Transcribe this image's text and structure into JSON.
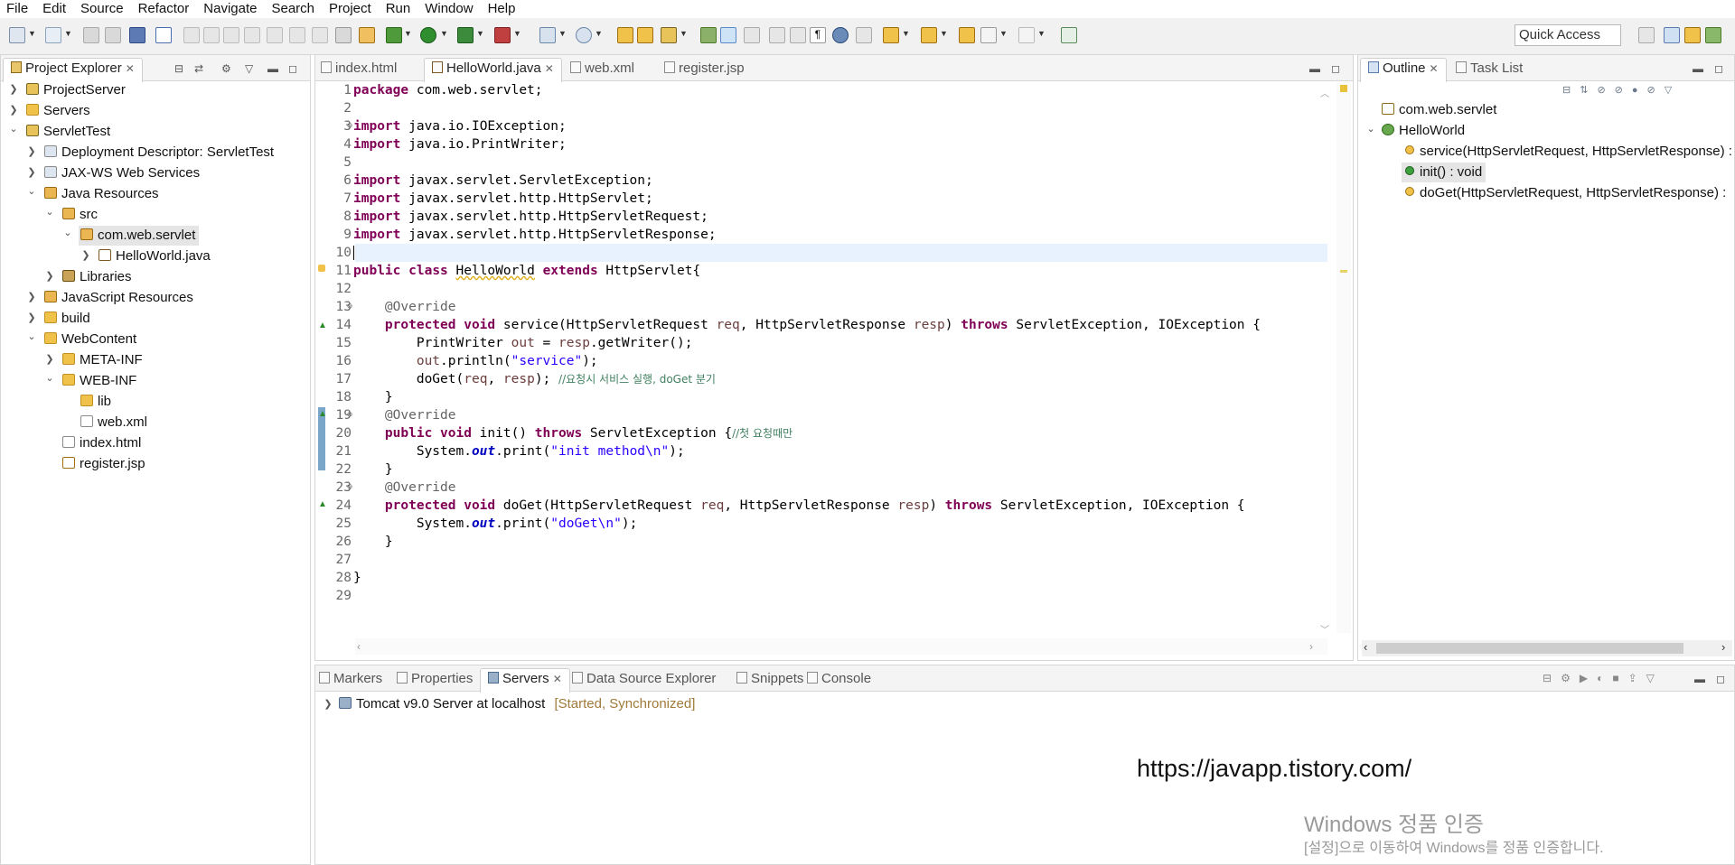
{
  "menu": [
    "File",
    "Edit",
    "Source",
    "Refactor",
    "Navigate",
    "Search",
    "Project",
    "Run",
    "Window",
    "Help"
  ],
  "toolbar": {
    "quick_access": "Quick Access"
  },
  "project_explorer": {
    "title": "Project Explorer",
    "items": [
      {
        "label": "ProjectServer"
      },
      {
        "label": "Servers"
      },
      {
        "label": "ServletTest"
      },
      {
        "label": "Deployment Descriptor: ServletTest"
      },
      {
        "label": "JAX-WS Web Services"
      },
      {
        "label": "Java Resources"
      },
      {
        "label": "src"
      },
      {
        "label": "com.web.servlet"
      },
      {
        "label": "HelloWorld.java"
      },
      {
        "label": "Libraries"
      },
      {
        "label": "JavaScript Resources"
      },
      {
        "label": "build"
      },
      {
        "label": "WebContent"
      },
      {
        "label": "META-INF"
      },
      {
        "label": "WEB-INF"
      },
      {
        "label": "lib"
      },
      {
        "label": "web.xml"
      },
      {
        "label": "index.html"
      },
      {
        "label": "register.jsp"
      }
    ]
  },
  "editor": {
    "tabs": [
      {
        "label": "index.html"
      },
      {
        "label": "HelloWorld.java"
      },
      {
        "label": "web.xml"
      },
      {
        "label": "register.jsp"
      }
    ],
    "line_numbers": [
      "1",
      "2",
      "3",
      "4",
      "5",
      "6",
      "7",
      "8",
      "9",
      "10",
      "11",
      "12",
      "13",
      "14",
      "15",
      "16",
      "17",
      "18",
      "19",
      "20",
      "21",
      "22",
      "23",
      "24",
      "25",
      "26",
      "27",
      "28",
      "29"
    ],
    "code": {
      "l1_kw": "package",
      "l1": " com.web.servlet;",
      "l3_kw": "import",
      "l3": " java.io.IOException;",
      "l4_kw": "import",
      "l4": " java.io.PrintWriter;",
      "l6_kw": "import",
      "l6": " javax.servlet.ServletException;",
      "l7_kw": "import",
      "l7": " javax.servlet.http.HttpServlet;",
      "l8_kw": "import",
      "l8": " javax.servlet.http.HttpServletRequest;",
      "l9_kw": "import",
      "l9": " javax.servlet.http.HttpServletResponse;",
      "l11_kw1": "public",
      "l11_kw2": "class",
      "l11_name": "HelloWorld",
      "l11_kw3": "extends",
      "l11_rest": " HttpServlet{",
      "l13": "@Override",
      "l14_kw": "protected void",
      "l14_a": " service(HttpServletRequest ",
      "l14_p1": "req",
      "l14_b": ", HttpServletResponse ",
      "l14_p2": "resp",
      "l14_c": ") ",
      "l14_kw2": "throws",
      "l14_d": " ServletException, IOException {",
      "l15_a": "PrintWriter ",
      "l15_v": "out",
      "l15_b": " = ",
      "l15_p": "resp",
      "l15_c": ".getWriter();",
      "l16_v": "out",
      "l16_a": ".println(",
      "l16_s": "\"service\"",
      "l16_b": ");",
      "l17_a": "doGet(",
      "l17_p1": "req",
      "l17_b": ", ",
      "l17_p2": "resp",
      "l17_c": "); ",
      "l17_cmt": "//요청시 서비스 실행, doGet 분기",
      "l18": "}",
      "l19": "@Override",
      "l20_kw": "public void",
      "l20_a": " init() ",
      "l20_kw2": "throws",
      "l20_b": " ServletException {",
      "l20_cmt": "//첫 요청때만",
      "l21_a": "System.",
      "l21_f": "out",
      "l21_b": ".print(",
      "l21_s": "\"init method\\n\"",
      "l21_c": ");",
      "l22": "}",
      "l23": "@Override",
      "l24_kw": "protected void",
      "l24_a": " doGet(HttpServletRequest ",
      "l24_p1": "req",
      "l24_b": ", HttpServletResponse ",
      "l24_p2": "resp",
      "l24_c": ") ",
      "l24_kw2": "throws",
      "l24_d": " ServletException, IOException {",
      "l25_a": "System.",
      "l25_f": "out",
      "l25_b": ".print(",
      "l25_s": "\"doGet\\n\"",
      "l25_c": ");",
      "l26": "}",
      "l28": "}"
    }
  },
  "outline": {
    "tabs": [
      {
        "label": "Outline"
      },
      {
        "label": "Task List"
      }
    ],
    "items": [
      {
        "label": "com.web.servlet"
      },
      {
        "label": "HelloWorld"
      },
      {
        "label": "service(HttpServletRequest, HttpServletResponse) :"
      },
      {
        "label": "init() : void"
      },
      {
        "label": "doGet(HttpServletRequest, HttpServletResponse) :"
      }
    ]
  },
  "bottom": {
    "tabs": [
      {
        "label": "Markers"
      },
      {
        "label": "Properties"
      },
      {
        "label": "Servers"
      },
      {
        "label": "Data Source Explorer"
      },
      {
        "label": "Snippets"
      },
      {
        "label": "Console"
      }
    ],
    "server_name": "Tomcat v9.0 Server at localhost",
    "server_status": "[Started, Synchronized]"
  },
  "watermarks": {
    "url": "https://javapp.tistory.com/",
    "windows_line1": "Windows 정품 인증",
    "windows_line2": "[설정]으로 이동하여 Windows를 정품 인증합니다."
  },
  "colors": {
    "keyword": "#7f0055",
    "string": "#2a00ff",
    "comment": "#3f7f5f",
    "annotation": "#646464",
    "field": "#0000c0"
  }
}
